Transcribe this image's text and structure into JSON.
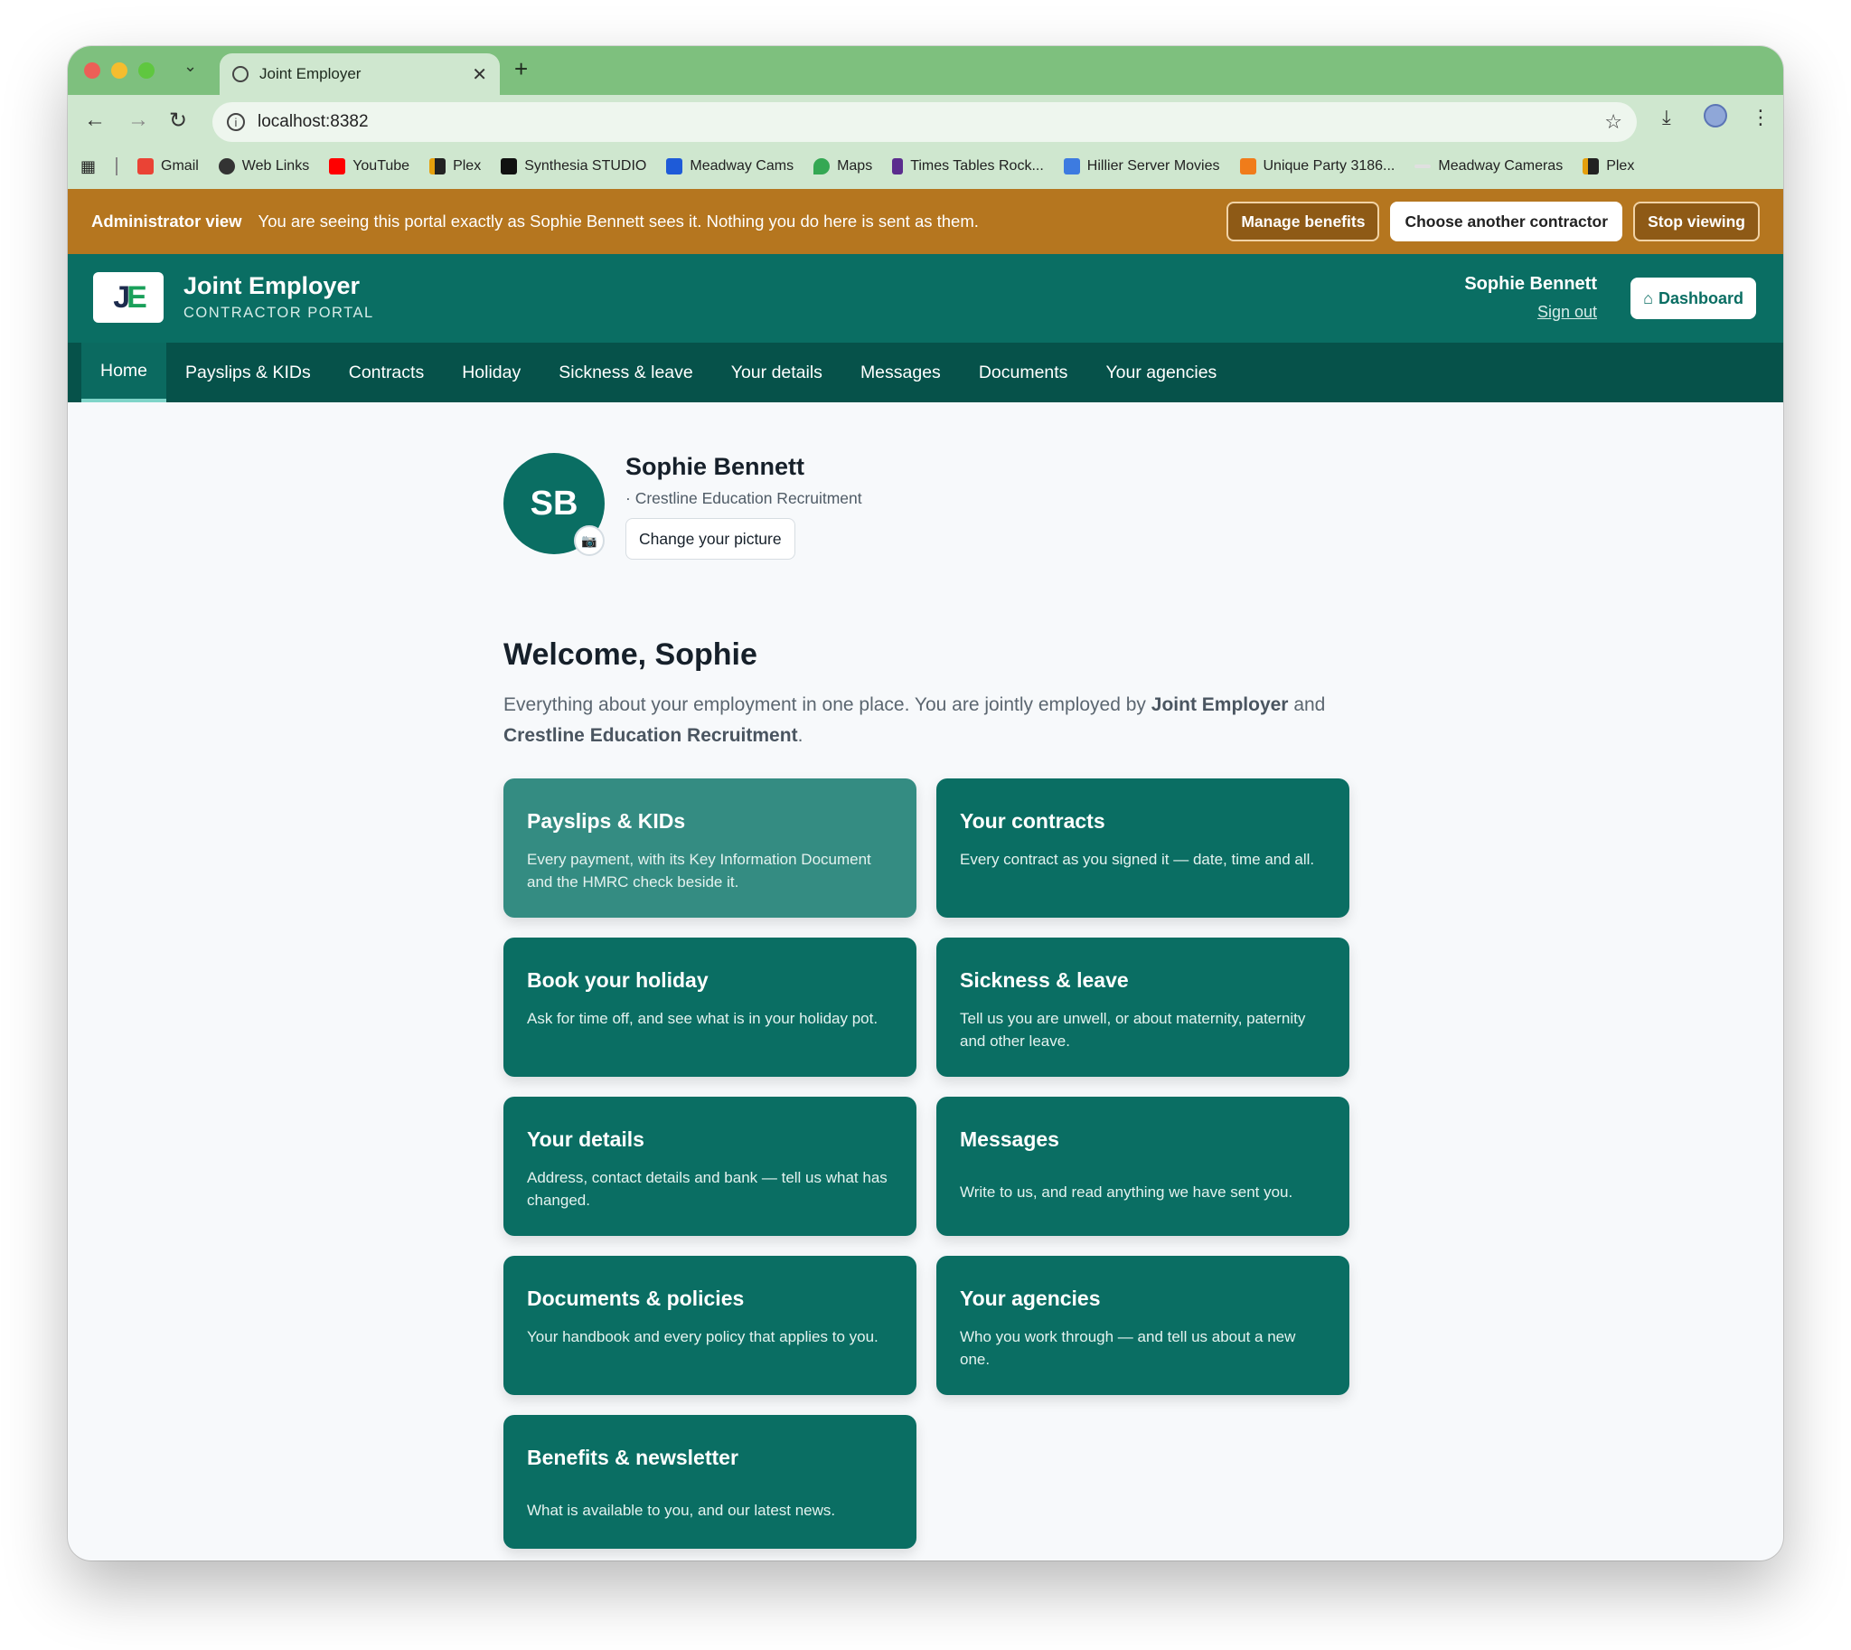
{
  "browser": {
    "tab_title": "Joint Employer",
    "url": "localhost:8382",
    "bookmarks": [
      {
        "label": "Gmail",
        "color": "#ea4335"
      },
      {
        "label": "Web Links",
        "color": "#333333"
      },
      {
        "label": "YouTube",
        "color": "#ff0000"
      },
      {
        "label": "Plex",
        "color": "#e5a00d"
      },
      {
        "label": "Synthesia STUDIO",
        "color": "#111111"
      },
      {
        "label": "Meadway Cams",
        "color": "#1e5bd8"
      },
      {
        "label": "Maps",
        "color": "#34a853"
      },
      {
        "label": "Times Tables Rock...",
        "color": "#5b2d8e"
      },
      {
        "label": "Hillier Server Movies",
        "color": "#3d7be0"
      },
      {
        "label": "Unique Party 3186...",
        "color": "#f07c1a"
      },
      {
        "label": "Meadway Cameras",
        "color": "#cccccc"
      },
      {
        "label": "Plex",
        "color": "#e5a00d"
      }
    ]
  },
  "admin": {
    "label": "Administrator view",
    "text": "You are seeing this portal exactly as Sophie Bennett sees it. Nothing you do here is sent as them.",
    "manage_benefits": "Manage benefits",
    "choose_contractor": "Choose another contractor",
    "stop_viewing": "Stop viewing",
    "bar_color": "#b5761f"
  },
  "header": {
    "logo_j": "J",
    "logo_e": "E",
    "brand": "Joint Employer",
    "subtitle": "CONTRACTOR PORTAL",
    "user_name": "Sophie Bennett",
    "sign_out": "Sign out",
    "dashboard": "Dashboard",
    "dashboard_icon": "⌂",
    "brand_color": "#0a6e63"
  },
  "nav": [
    {
      "label": "Home",
      "active": true
    },
    {
      "label": "Payslips & KIDs"
    },
    {
      "label": "Contracts"
    },
    {
      "label": "Holiday"
    },
    {
      "label": "Sickness & leave"
    },
    {
      "label": "Your details"
    },
    {
      "label": "Messages"
    },
    {
      "label": "Documents"
    },
    {
      "label": "Your agencies"
    }
  ],
  "profile": {
    "initials": "SB",
    "name": "Sophie Bennett",
    "agency": "· Crestline Education Recruitment",
    "change_picture": "Change your picture",
    "camera_icon": "📷"
  },
  "welcome": {
    "heading": "Welcome, Sophie",
    "intro_1": "Everything about your employment in one place. You are jointly employed by ",
    "intro_employer": "Joint Employer",
    "intro_2": " and ",
    "intro_agency": "Crestline Education Recruitment",
    "intro_3": "."
  },
  "cards": [
    {
      "title": "Payslips & KIDs",
      "desc": "Every payment, with its Key Information Document and the HMRC check beside it."
    },
    {
      "title": "Your contracts",
      "desc": "Every contract as you signed it — date, time and all."
    },
    {
      "title": "Book your holiday",
      "desc": "Ask for time off, and see what is in your holiday pot."
    },
    {
      "title": "Sickness & leave",
      "desc": "Tell us you are unwell, or about maternity, paternity and other leave."
    },
    {
      "title": "Your details",
      "desc": "Address, contact details and bank — tell us what has changed."
    },
    {
      "title": "Messages",
      "desc": "Write to us, and read anything we have sent you."
    },
    {
      "title": "Documents & policies",
      "desc": "Your handbook and every policy that applies to you."
    },
    {
      "title": "Your agencies",
      "desc": "Who you work through — and tell us about a new one."
    },
    {
      "title": "Benefits & newsletter",
      "desc": "What is available to you, and our latest news."
    }
  ]
}
